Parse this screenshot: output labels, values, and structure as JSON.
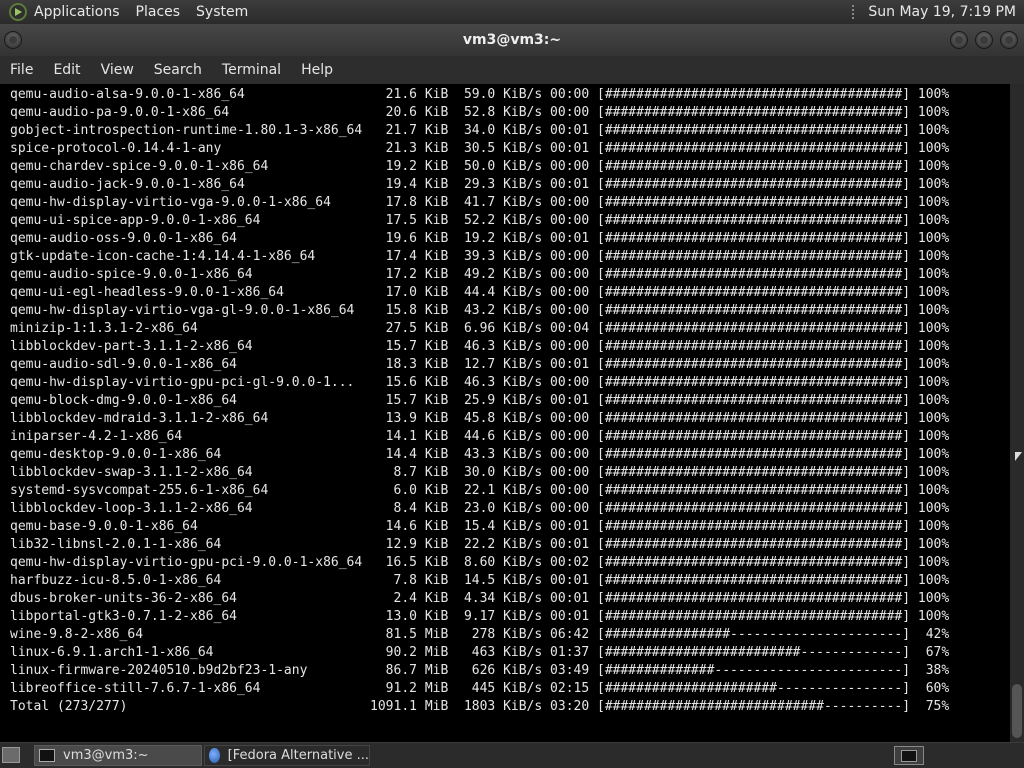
{
  "top_panel": {
    "menus": [
      "Applications",
      "Places",
      "System"
    ],
    "clock": "Sun May 19,  7:19 PM"
  },
  "window": {
    "title": "vm3@vm3:~"
  },
  "menubar": [
    "File",
    "Edit",
    "View",
    "Search",
    "Terminal",
    "Help"
  ],
  "terminal": {
    "lines": [
      "qemu-audio-alsa-9.0.0-1-x86_64                  21.6 KiB  59.0 KiB/s 00:00 [######################################] 100%",
      "qemu-audio-pa-9.0.0-1-x86_64                    20.6 KiB  52.8 KiB/s 00:00 [######################################] 100%",
      "gobject-introspection-runtime-1.80.1-3-x86_64   21.7 KiB  34.0 KiB/s 00:01 [######################################] 100%",
      "spice-protocol-0.14.4-1-any                     21.3 KiB  30.5 KiB/s 00:01 [######################################] 100%",
      "qemu-chardev-spice-9.0.0-1-x86_64               19.2 KiB  50.0 KiB/s 00:00 [######################################] 100%",
      "qemu-audio-jack-9.0.0-1-x86_64                  19.4 KiB  29.3 KiB/s 00:01 [######################################] 100%",
      "qemu-hw-display-virtio-vga-9.0.0-1-x86_64       17.8 KiB  41.7 KiB/s 00:00 [######################################] 100%",
      "qemu-ui-spice-app-9.0.0-1-x86_64                17.5 KiB  52.2 KiB/s 00:00 [######################################] 100%",
      "qemu-audio-oss-9.0.0-1-x86_64                   19.6 KiB  19.2 KiB/s 00:01 [######################################] 100%",
      "gtk-update-icon-cache-1:4.14.4-1-x86_64         17.4 KiB  39.3 KiB/s 00:00 [######################################] 100%",
      "qemu-audio-spice-9.0.0-1-x86_64                 17.2 KiB  49.2 KiB/s 00:00 [######################################] 100%",
      "qemu-ui-egl-headless-9.0.0-1-x86_64             17.0 KiB  44.4 KiB/s 00:00 [######################################] 100%",
      "qemu-hw-display-virtio-vga-gl-9.0.0-1-x86_64    15.8 KiB  43.2 KiB/s 00:00 [######################################] 100%",
      "minizip-1:1.3.1-2-x86_64                        27.5 KiB  6.96 KiB/s 00:04 [######################################] 100%",
      "libblockdev-part-3.1.1-2-x86_64                 15.7 KiB  46.3 KiB/s 00:00 [######################################] 100%",
      "qemu-audio-sdl-9.0.0-1-x86_64                   18.3 KiB  12.7 KiB/s 00:01 [######################################] 100%",
      "qemu-hw-display-virtio-gpu-pci-gl-9.0.0-1...    15.6 KiB  46.3 KiB/s 00:00 [######################################] 100%",
      "qemu-block-dmg-9.0.0-1-x86_64                   15.7 KiB  25.9 KiB/s 00:01 [######################################] 100%",
      "libblockdev-mdraid-3.1.1-2-x86_64               13.9 KiB  45.8 KiB/s 00:00 [######################################] 100%",
      "iniparser-4.2-1-x86_64                          14.1 KiB  44.6 KiB/s 00:00 [######################################] 100%",
      "qemu-desktop-9.0.0-1-x86_64                     14.4 KiB  43.3 KiB/s 00:00 [######################################] 100%",
      "libblockdev-swap-3.1.1-2-x86_64                  8.7 KiB  30.0 KiB/s 00:00 [######################################] 100%",
      "systemd-sysvcompat-255.6-1-x86_64                6.0 KiB  22.1 KiB/s 00:00 [######################################] 100%",
      "libblockdev-loop-3.1.1-2-x86_64                  8.4 KiB  23.0 KiB/s 00:00 [######################################] 100%",
      "qemu-base-9.0.0-1-x86_64                        14.6 KiB  15.4 KiB/s 00:01 [######################################] 100%",
      "lib32-libnsl-2.0.1-1-x86_64                     12.9 KiB  22.2 KiB/s 00:01 [######################################] 100%",
      "qemu-hw-display-virtio-gpu-pci-9.0.0-1-x86_64   16.5 KiB  8.60 KiB/s 00:02 [######################################] 100%",
      "harfbuzz-icu-8.5.0-1-x86_64                      7.8 KiB  14.5 KiB/s 00:01 [######################################] 100%",
      "dbus-broker-units-36-2-x86_64                    2.4 KiB  4.34 KiB/s 00:01 [######################################] 100%",
      "libportal-gtk3-0.7.1-2-x86_64                   13.0 KiB  9.17 KiB/s 00:01 [######################################] 100%",
      "wine-9.8-2-x86_64                               81.5 MiB   278 KiB/s 06:42 [################----------------------]  42%",
      "linux-6.9.1.arch1-1-x86_64                      90.2 MiB   463 KiB/s 01:37 [#########################-------------]  67%",
      "linux-firmware-20240510.b9d2bf23-1-any          86.7 MiB   626 KiB/s 03:49 [##############------------------------]  38%",
      "libreoffice-still-7.6.7-1-x86_64                91.2 MiB   445 KiB/s 02:15 [######################----------------]  60%",
      "Total (273/277)                               1091.1 MiB  1803 KiB/s 03:20 [############################----------]  75%"
    ]
  },
  "taskbar": {
    "tasks": [
      "vm3@vm3:~",
      "[Fedora Alternative ..."
    ]
  }
}
